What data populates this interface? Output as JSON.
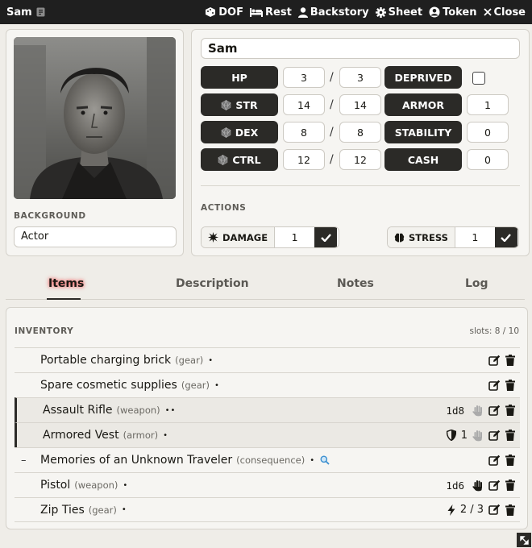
{
  "window": {
    "title": "Sam",
    "controls": [
      {
        "label": "DOF",
        "icon": "dice-icon"
      },
      {
        "label": "Rest",
        "icon": "bed-icon"
      },
      {
        "label": "Backstory",
        "icon": "user-icon"
      },
      {
        "label": "Sheet",
        "icon": "gear-icon"
      },
      {
        "label": "Token",
        "icon": "user-circle-icon"
      },
      {
        "label": "Close",
        "icon": "close-icon"
      }
    ]
  },
  "character": {
    "name": "Sam",
    "background_label": "BACKGROUND",
    "background": "Actor"
  },
  "stats": {
    "hp": {
      "label": "HP",
      "current": "3",
      "max": "3"
    },
    "str": {
      "label": "STR",
      "current": "14",
      "max": "14"
    },
    "dex": {
      "label": "DEX",
      "current": "8",
      "max": "8"
    },
    "ctrl": {
      "label": "CTRL",
      "current": "12",
      "max": "12"
    },
    "deprived": {
      "label": "DEPRIVED",
      "checked": false
    },
    "armor": {
      "label": "ARMOR",
      "value": "1"
    },
    "stability": {
      "label": "STABILITY",
      "value": "0"
    },
    "cash": {
      "label": "CASH",
      "value": "0"
    },
    "slash": "/"
  },
  "actions": {
    "label": "ACTIONS",
    "damage": {
      "label": "DAMAGE",
      "value": "1"
    },
    "stress": {
      "label": "STRESS",
      "value": "1"
    }
  },
  "tabs": [
    {
      "label": "Items",
      "active": true
    },
    {
      "label": "Description",
      "active": false
    },
    {
      "label": "Notes",
      "active": false
    },
    {
      "label": "Log",
      "active": false
    }
  ],
  "inventory": {
    "label": "INVENTORY",
    "slots": "slots: 8 / 10",
    "items": [
      {
        "name": "Portable charging brick",
        "type": "(gear)",
        "dots": "•",
        "equipped": false
      },
      {
        "name": "Spare cosmetic supplies",
        "type": "(gear)",
        "dots": "•",
        "equipped": false
      },
      {
        "name": "Assault Rifle",
        "type": "(weapon)",
        "dots": "••",
        "equipped": true,
        "dice": "1d8"
      },
      {
        "name": "Armored Vest",
        "type": "(armor)",
        "dots": "•",
        "equipped": true,
        "armor": "1"
      },
      {
        "name": "Memories of an Unknown Traveler",
        "type": "(consequence)",
        "dots": "•",
        "equipped": false,
        "dash": "–"
      },
      {
        "name": "Pistol",
        "type": "(weapon)",
        "dots": "•",
        "equipped": false,
        "dice": "1d6"
      },
      {
        "name": "Zip Ties",
        "type": "(gear)",
        "dots": "•",
        "equipped": false,
        "uses": "2 / 3"
      }
    ]
  },
  "colors": {
    "titlebar": "#1f1f1f",
    "pill": "#2b2a27",
    "tab_glow": "#e75f5f",
    "background": "#efede8"
  }
}
